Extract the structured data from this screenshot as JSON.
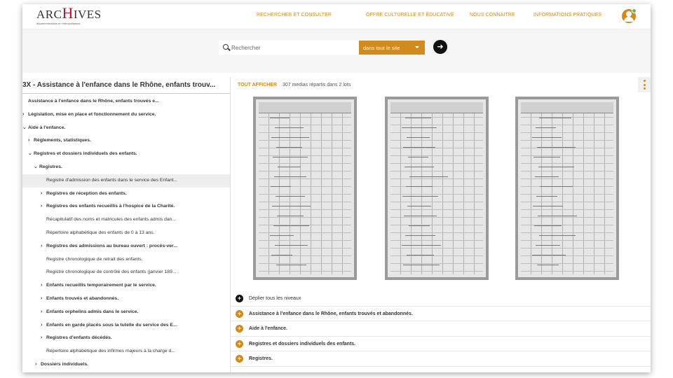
{
  "brand": {
    "logo_text_pre": "ARC",
    "logo_text_h": "H",
    "logo_text_post": "IVES",
    "logo_subtitle": "départementales et métropolitaines"
  },
  "nav": {
    "items": [
      "RECHERCHER ET CONSULTER",
      "OFFRE CULTURELLE ET ÉDUCATIVE",
      "NOUS CONNAITRE",
      "INFORMATIONS PRATIQUES"
    ]
  },
  "search": {
    "placeholder": "Rechercher",
    "scope_label": "dans tout le site",
    "go_icon": "arrow-right-icon"
  },
  "left": {
    "title": "3X - Assistance à l'enfance dans le Rhône, enfants trouv...",
    "items": [
      {
        "label": "Assistance à l'enfance dans le Rhône, enfants trouvés e...",
        "chev": ""
      },
      {
        "label": "Législation, mise en place et fonctionnement du service.",
        "chev": "›"
      },
      {
        "label": "Aide à l'enfance.",
        "chev": "⌄"
      },
      {
        "label": "Règlements, statistiques.",
        "chev": "›"
      },
      {
        "label": "Registres et dossiers individuels des enfants.",
        "chev": "⌄"
      },
      {
        "label": "Registres.",
        "chev": "⌄"
      },
      {
        "label": "Registre d'admission des enfants dans le service des Enfant...",
        "chev": ""
      },
      {
        "label": "Registres de réception des enfants.",
        "chev": "›"
      },
      {
        "label": "Registres des enfants recueillis à l'hospice de la Charité.",
        "chev": "›"
      },
      {
        "label": "Récapitulatif des noms et matricules des enfants admis dan...",
        "chev": ""
      },
      {
        "label": "Répertoire alphabétique des enfants de 0 à 13 ans.",
        "chev": ""
      },
      {
        "label": "Registres des admissions au bureau ouvert : procès-ver...",
        "chev": "›"
      },
      {
        "label": "Registre chronologique de retrait des enfants.",
        "chev": ""
      },
      {
        "label": "Registre chronologique de contrôle des enfants (janvier 189...",
        "chev": ""
      },
      {
        "label": "Enfants recueillis temporairement par le service.",
        "chev": "›"
      },
      {
        "label": "Enfants trouvés et abandonnés.",
        "chev": "›"
      },
      {
        "label": "Enfants orphelins admis dans le service.",
        "chev": "›"
      },
      {
        "label": "Enfants en garde placés sous la tutelle du service des E...",
        "chev": "›"
      },
      {
        "label": "Registres d'enfants décédés.",
        "chev": "›"
      },
      {
        "label": "Répertoire alphabétique des infirmes majeurs à la charge d...",
        "chev": ""
      },
      {
        "label": "Dossiers individuels.",
        "chev": "›"
      }
    ]
  },
  "right": {
    "show_all": "TOUT AFFICHER",
    "media_count": "307 medias répartis dans 2 lots",
    "rows": [
      {
        "label": "Déplier tous les niveaux",
        "icon": "+"
      },
      {
        "label": "Assistance à l'enfance dans le Rhône, enfants trouvés et abandonnés.",
        "icon": "+"
      },
      {
        "label": "Aide à l'enfance.",
        "icon": "+"
      },
      {
        "label": "Registres et dossiers individuels des enfants.",
        "icon": "+"
      },
      {
        "label": "Registres.",
        "icon": "+"
      }
    ]
  },
  "colors": {
    "accent": "#d18a1b",
    "nav": "#d48b1e",
    "brand_red": "#c8102e"
  }
}
